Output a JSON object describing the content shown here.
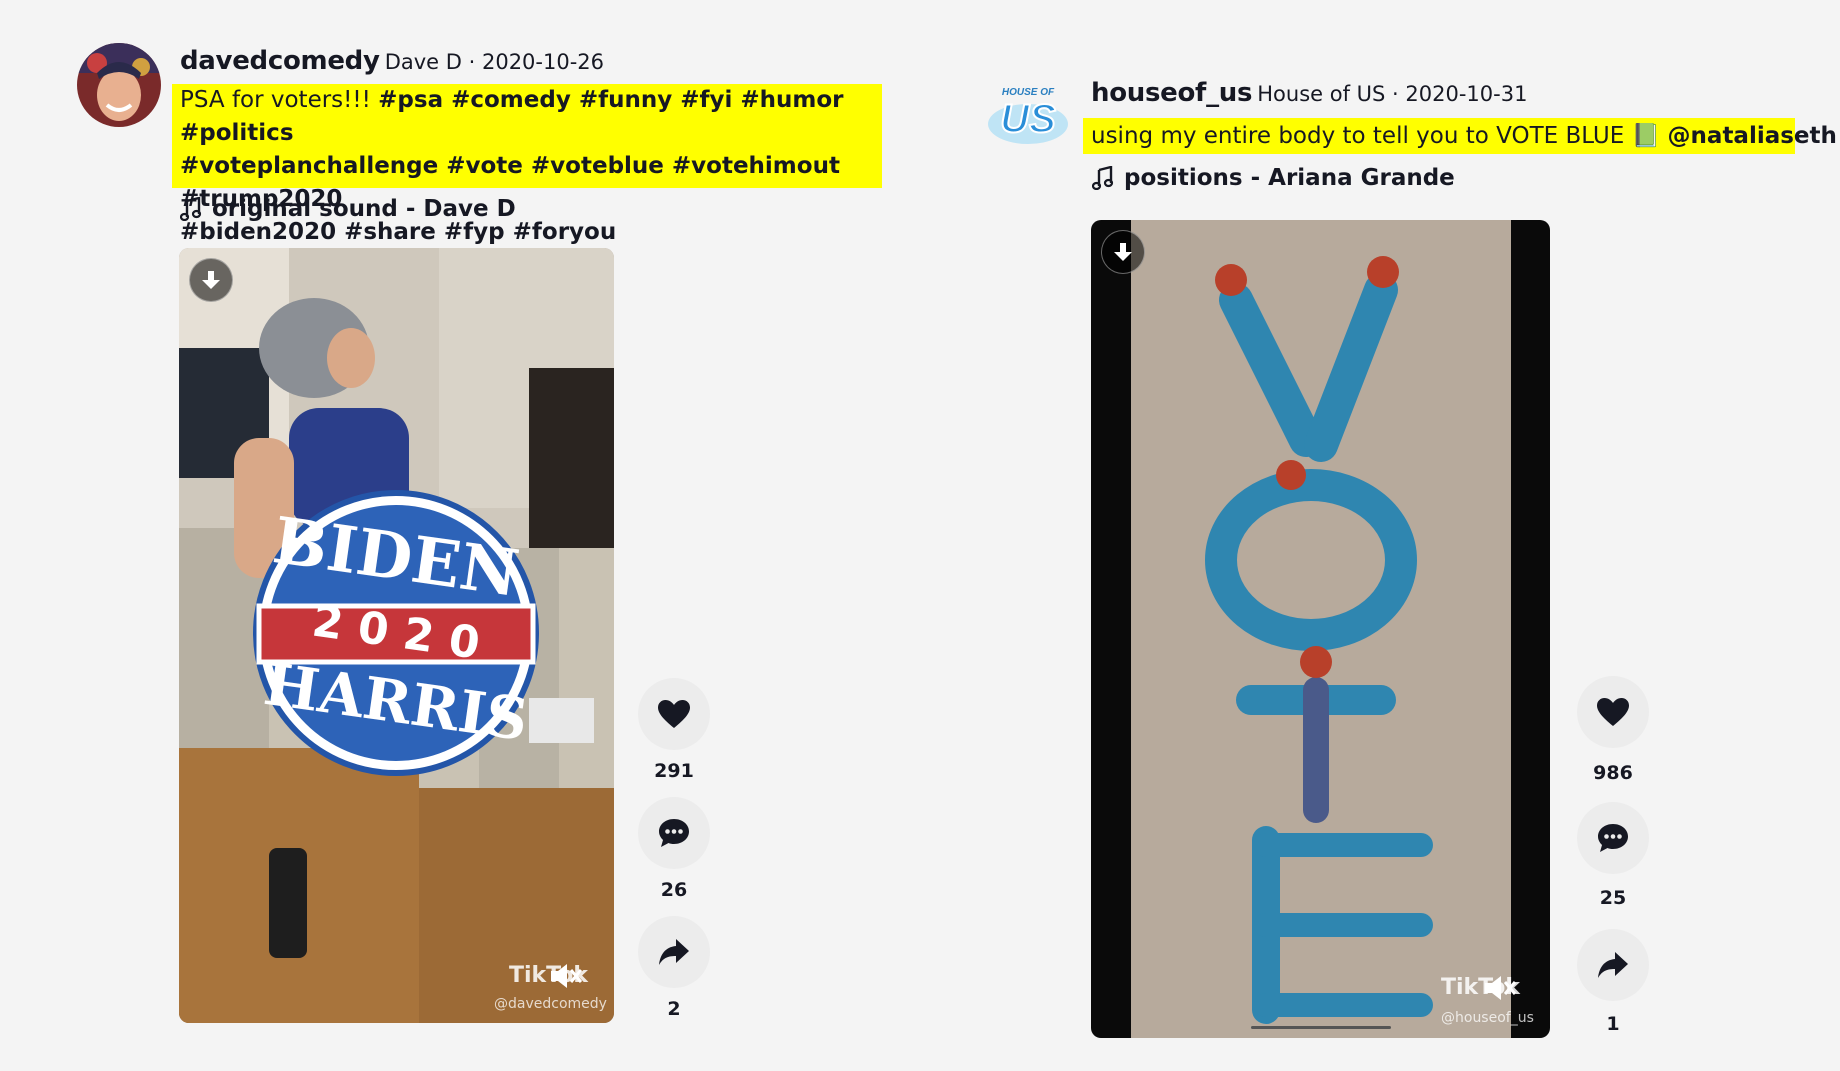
{
  "post1": {
    "username": "davedcomedy",
    "display_name": "Dave D",
    "date": "2020-10-26",
    "caption_plain": "PSA for voters!!! ",
    "caption_tags_line1": "#psa #comedy #funny #fyi #humor #politics",
    "caption_tags_line2": "#voteplanchallenge #vote #voteblue #votehimout #trump2020",
    "caption_tags_line3": "#biden2020 #share #fyp #foryou",
    "music": "original sound - Dave D",
    "sticker_top": "BIDEN",
    "sticker_mid": "2 0 2 0",
    "sticker_bottom": "HARRIS",
    "watermark": "TikTok",
    "watermark_handle": "@davedcomedy",
    "likes": "291",
    "comments": "26",
    "shares": "2"
  },
  "post2": {
    "username": "houseof_us",
    "display_name": "House of US",
    "date": "2020-10-31",
    "caption_plain": "using my entire body to tell you to VOTE BLUE ",
    "caption_emoji": "📗",
    "caption_mention": "@nataliaseth",
    "music": "positions - Ariana Grande",
    "avatar_text_top": "HOUSE OF",
    "avatar_text_main": "US",
    "watermark": "TikTok",
    "watermark_handle": "@houseof_us",
    "likes": "986",
    "comments": "25",
    "shares": "1"
  }
}
